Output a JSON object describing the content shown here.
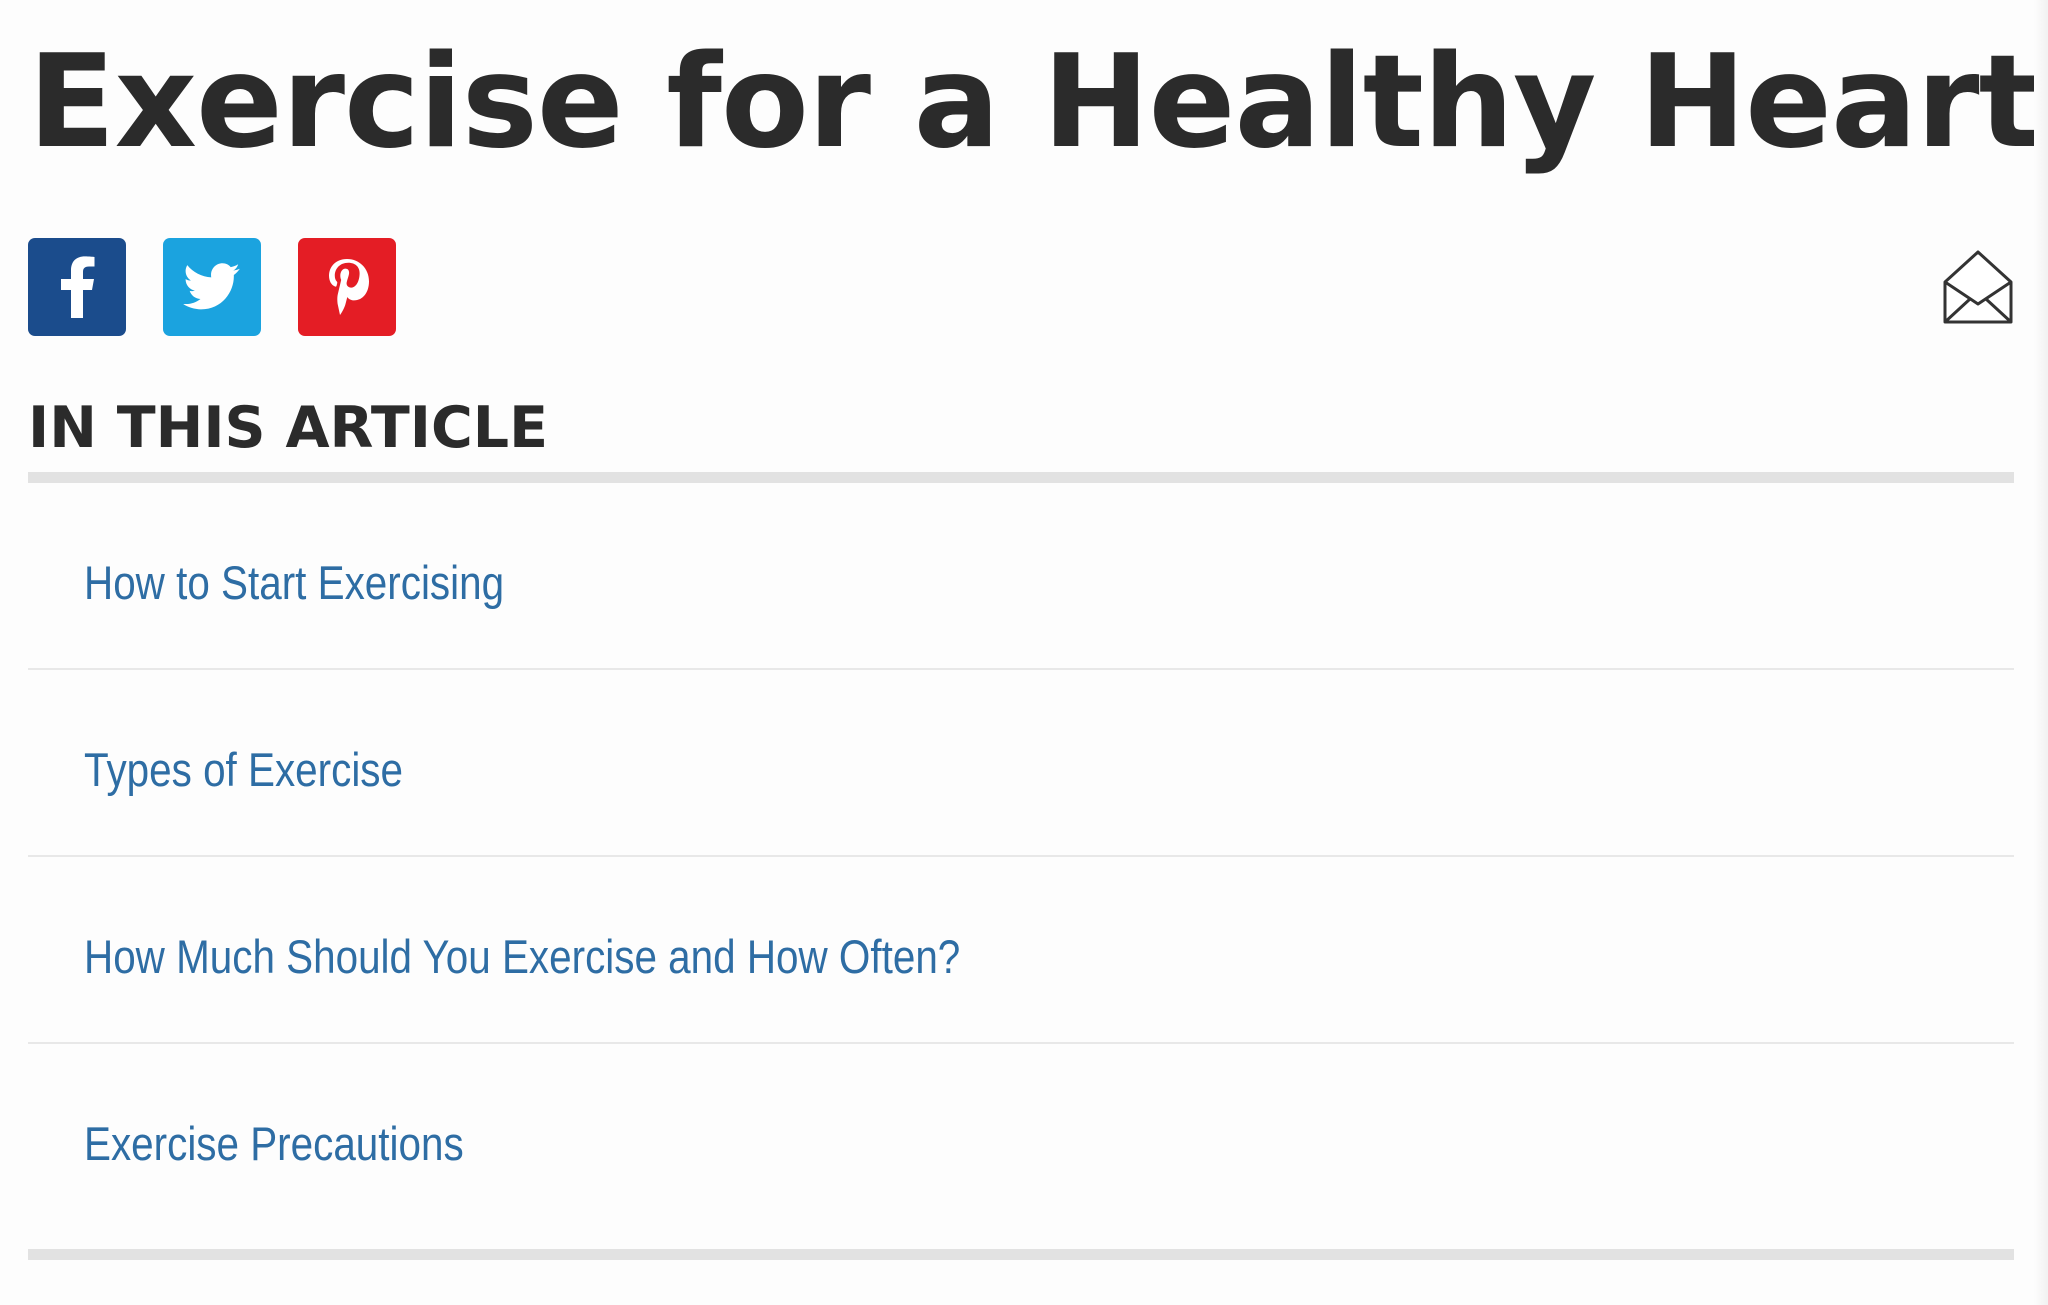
{
  "article": {
    "title": "Exercise for a Healthy Heart"
  },
  "share": {
    "buttons": [
      {
        "network": "facebook",
        "icon": "facebook-icon",
        "color": "#1b4c8c"
      },
      {
        "network": "twitter",
        "icon": "twitter-icon",
        "color": "#1ba3df"
      },
      {
        "network": "pinterest",
        "icon": "pinterest-icon",
        "color": "#e41d25"
      }
    ],
    "email_icon": "envelope-icon"
  },
  "toc": {
    "heading": "IN THIS ARTICLE",
    "items": [
      {
        "label": "How to Start Exercising"
      },
      {
        "label": "Types of Exercise"
      },
      {
        "label": "How Much Should You Exercise and How Often?"
      },
      {
        "label": "Exercise Precautions"
      }
    ],
    "link_color": "#2e6da4"
  }
}
